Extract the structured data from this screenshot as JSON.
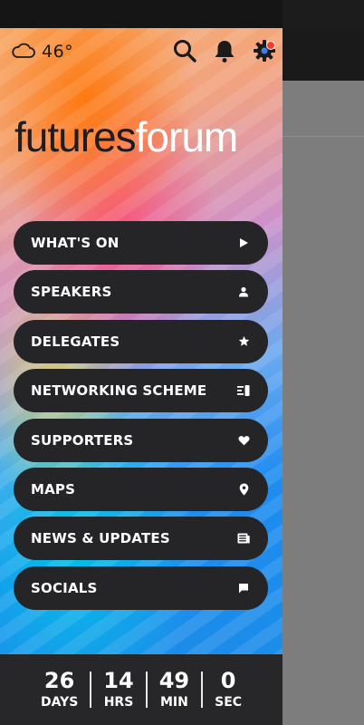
{
  "weather": {
    "temperature": "46°",
    "icon": "cloud-icon"
  },
  "header": {
    "icons": [
      "search-icon",
      "bell-icon",
      "gear-icon"
    ],
    "notification_dot_color": "#ff3a2b"
  },
  "logo": {
    "part1": "futures",
    "part2": "forum"
  },
  "menu": {
    "items": [
      {
        "label": "WHAT'S ON",
        "icon": "play-icon"
      },
      {
        "label": "SPEAKERS",
        "icon": "person-icon"
      },
      {
        "label": "DELEGATES",
        "icon": "star-icon"
      },
      {
        "label": "NETWORKING SCHEME",
        "icon": "list-icon"
      },
      {
        "label": "SUPPORTERS",
        "icon": "heart-icon"
      },
      {
        "label": "MAPS",
        "icon": "map-pin-icon"
      },
      {
        "label": "NEWS & UPDATES",
        "icon": "newspaper-icon"
      },
      {
        "label": "SOCIALS",
        "icon": "chat-icon"
      }
    ]
  },
  "countdown": {
    "days": {
      "value": "26",
      "label": "DAYS"
    },
    "hours": {
      "value": "14",
      "label": "HRS"
    },
    "minutes": {
      "value": "49",
      "label": "MIN"
    },
    "seconds": {
      "value": "0",
      "label": "SEC"
    }
  },
  "colors": {
    "menu_bg": "#252427",
    "countdown_bg": "#272628",
    "logo_dark": "#1d1d22"
  }
}
